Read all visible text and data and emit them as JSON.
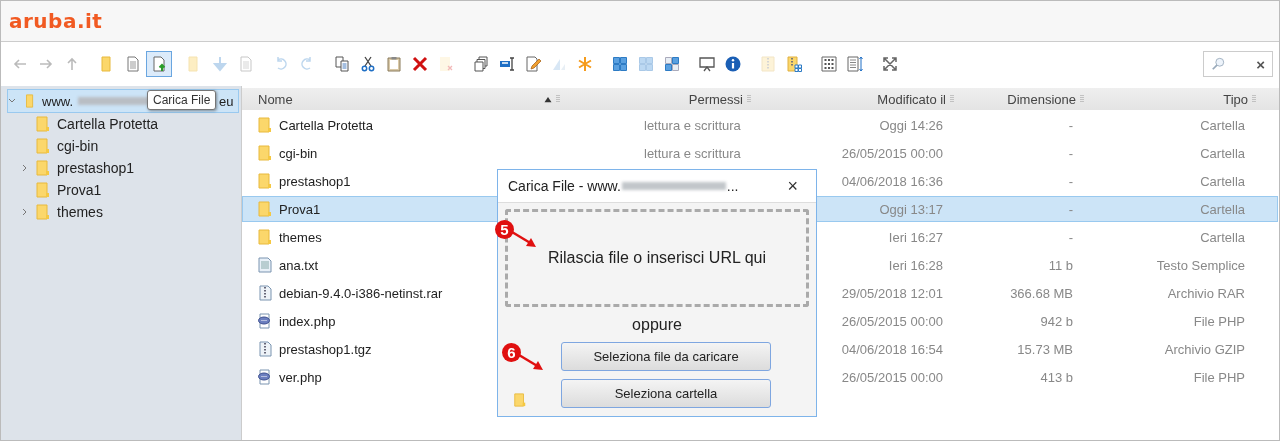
{
  "logo": "aruba.it",
  "toolbar": {
    "groups": [
      [
        {
          "kind": "back",
          "disabled": true,
          "hovered": false
        },
        {
          "kind": "forward",
          "disabled": true,
          "hovered": false
        },
        {
          "kind": "up",
          "disabled": true,
          "hovered": false
        }
      ],
      [
        {
          "kind": "folder",
          "disabled": false,
          "hovered": false
        },
        {
          "kind": "file",
          "disabled": false,
          "hovered": false
        },
        {
          "kind": "upload",
          "disabled": false,
          "hovered": true
        }
      ],
      [
        {
          "kind": "folder",
          "disabled": true,
          "hovered": false
        },
        {
          "kind": "download",
          "disabled": true,
          "hovered": false
        },
        {
          "kind": "file",
          "disabled": true,
          "hovered": false
        }
      ],
      [
        {
          "kind": "undo",
          "disabled": true,
          "hovered": false
        },
        {
          "kind": "redo",
          "disabled": true,
          "hovered": false
        }
      ],
      [
        {
          "kind": "copy",
          "disabled": false,
          "hovered": false
        },
        {
          "kind": "cut",
          "disabled": false,
          "hovered": false
        },
        {
          "kind": "paste",
          "disabled": false,
          "hovered": false
        },
        {
          "kind": "delete",
          "disabled": false,
          "hovered": false
        },
        {
          "kind": "clear",
          "disabled": true,
          "hovered": false
        }
      ],
      [
        {
          "kind": "duplicate",
          "disabled": false,
          "hovered": false
        },
        {
          "kind": "rename",
          "disabled": false,
          "hovered": false
        },
        {
          "kind": "edit",
          "disabled": false,
          "hovered": false
        },
        {
          "kind": "resize",
          "disabled": true,
          "hovered": false
        },
        {
          "kind": "star",
          "disabled": false,
          "hovered": false
        }
      ],
      [
        {
          "kind": "grid",
          "disabled": false,
          "hovered": false
        },
        {
          "kind": "grid",
          "disabled": true,
          "hovered": false
        },
        {
          "kind": "tiles",
          "disabled": false,
          "hovered": false
        }
      ],
      [
        {
          "kind": "preview",
          "disabled": false,
          "hovered": false
        },
        {
          "kind": "info",
          "disabled": false,
          "hovered": false
        }
      ],
      [
        {
          "kind": "archive",
          "disabled": true,
          "hovered": false
        },
        {
          "kind": "extract",
          "disabled": false,
          "hovered": false
        }
      ],
      [
        {
          "kind": "view",
          "disabled": false,
          "hovered": false
        },
        {
          "kind": "columns",
          "disabled": false,
          "hovered": false
        }
      ],
      [
        {
          "kind": "fullscreen",
          "disabled": false,
          "hovered": false
        }
      ]
    ],
    "search": {
      "clear": "×"
    },
    "tooltip": "Carica File"
  },
  "tree": {
    "root": {
      "label_start": "www.",
      "label_end": "eu",
      "expanded": true,
      "selected": true
    },
    "items": [
      {
        "label": "Cartella Protetta",
        "has_children": false
      },
      {
        "label": "cgi-bin",
        "has_children": false
      },
      {
        "label": "prestashop1",
        "has_children": true
      },
      {
        "label": "Prova1",
        "has_children": false
      },
      {
        "label": "themes",
        "has_children": true
      }
    ]
  },
  "table": {
    "columns": [
      {
        "label": "Nome",
        "sorted": true
      },
      {
        "label": "Permessi",
        "sorted": false
      },
      {
        "label": "Modificato il",
        "sorted": false
      },
      {
        "label": "Dimensione",
        "sorted": false
      },
      {
        "label": "Tipo",
        "sorted": false
      }
    ],
    "rows": [
      {
        "kind": "folder",
        "name": "Cartella Protetta",
        "permissions": "lettura e scrittura",
        "modified": "Oggi 14:26",
        "size": "-",
        "type": "Cartella",
        "selected": false
      },
      {
        "kind": "folder",
        "name": "cgi-bin",
        "permissions": "lettura e scrittura",
        "modified": "26/05/2015 00:00",
        "size": "-",
        "type": "Cartella",
        "selected": false
      },
      {
        "kind": "folder",
        "name": "prestashop1",
        "modified": "04/06/2018 16:36",
        "size": "-",
        "type": "Cartella",
        "selected": false
      },
      {
        "kind": "folder",
        "name": "Prova1",
        "modified": "Oggi 13:17",
        "size": "-",
        "type": "Cartella",
        "selected": true
      },
      {
        "kind": "folder",
        "name": "themes",
        "modified": "Ieri 16:27",
        "size": "-",
        "type": "Cartella",
        "selected": false
      },
      {
        "kind": "text",
        "name": "ana.txt",
        "modified": "Ieri 16:28",
        "size": "11 b",
        "type": "Testo Semplice",
        "selected": false
      },
      {
        "kind": "archive",
        "name": "debian-9.4.0-i386-netinst.rar",
        "modified": "29/05/2018 12:01",
        "size": "366.68 MB",
        "type": "Archivio RAR",
        "selected": false
      },
      {
        "kind": "script",
        "name": "index.php",
        "modified": "26/05/2015 00:00",
        "size": "942 b",
        "type": "File PHP",
        "selected": false
      },
      {
        "kind": "archive",
        "name": "prestashop1.tgz",
        "modified": "04/06/2018 16:54",
        "size": "15.73 MB",
        "type": "Archivio GZIP",
        "selected": false
      },
      {
        "kind": "script",
        "name": "ver.php",
        "modified": "26/05/2015 00:00",
        "size": "413 b",
        "type": "File PHP",
        "selected": false
      }
    ]
  },
  "dialog": {
    "title_start": "Carica File - www.",
    "title_end": "...",
    "close": "×",
    "drop_zone": "Rilascia file o inserisci URL qui",
    "separator": "oppure",
    "buttons": [
      "Seleziona file da caricare",
      "Seleziona cartella"
    ]
  },
  "annotations": [
    {
      "number": "5"
    },
    {
      "number": "6"
    }
  ]
}
